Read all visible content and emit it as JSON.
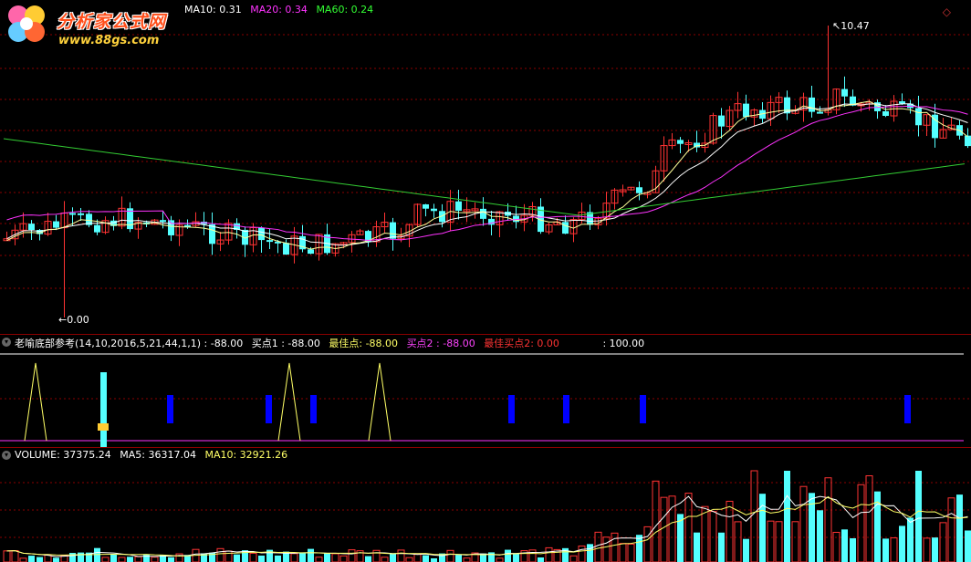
{
  "watermark": {
    "title": "分析家公式网",
    "url": "www.88gs.com"
  },
  "main_panel": {
    "ma_labels": [
      {
        "text": "MA10: 0.31",
        "color": "#ffffff"
      },
      {
        "text": "MA20: 0.34",
        "color": "#ff33ff"
      },
      {
        "text": "MA60: 0.24",
        "color": "#33ff33"
      }
    ],
    "high_label": "10.47",
    "low_label": "0.00",
    "scroll_icon": "diamond-icon"
  },
  "indicator_panel": {
    "name": "老喻底部参考",
    "params": "(14,10,2016,5,21,44,1,1)",
    "values": [
      {
        "text": ": -88.00",
        "color": "#ffffff"
      },
      {
        "text": "买点1 : -88.00",
        "color": "#ffffff"
      },
      {
        "text": "最佳点: -88.00",
        "color": "#ffff66"
      },
      {
        "text": "买点2 : -88.00",
        "color": "#ff44ff"
      },
      {
        "text": "最佳买点2: 0.00",
        "color": "#ff3333"
      },
      {
        "text": ": 100.00",
        "color": "#ffffff"
      }
    ]
  },
  "volume_panel": {
    "labels": [
      {
        "text": "VOLUME: 37375.24",
        "color": "#ffffff"
      },
      {
        "text": "MA5: 36317.04",
        "color": "#ffffff"
      },
      {
        "text": "MA10: 32921.26",
        "color": "#ffff66"
      }
    ]
  },
  "colors": {
    "up": "#ff3333",
    "down": "#54ffff",
    "ma10": "#ffffff",
    "ma20": "#ff33ff",
    "ma60": "#33cc33",
    "grid": "#8b0000",
    "signal": "#0000ff",
    "triangle": "#ffff66"
  }
}
